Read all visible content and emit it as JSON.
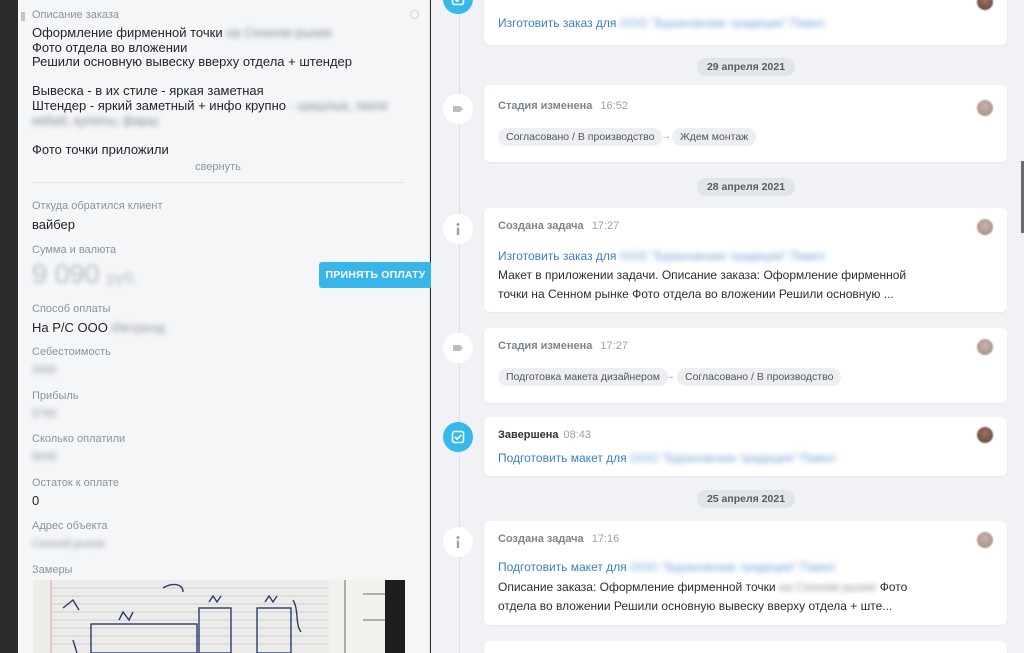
{
  "order": {
    "description_label": "Описание заказа",
    "description_lines": [
      {
        "text": "Оформление фирменной точки",
        "blur": "на Сенном рынке"
      },
      {
        "text": "Фото отдела во вложении",
        "blur": ""
      },
      {
        "text": "Решили основную вывеску вверху отдела + штендер",
        "blur": ""
      },
      {
        "text": "Вывеска - в их стиле - яркая заметная",
        "blur": ""
      },
      {
        "text": "Штендер - яркий заметный + инфо крупно",
        "blur": "- шашлык, люля"
      },
      {
        "text": "",
        "blur": "кебаб, купаты, фарш"
      },
      {
        "text": "Фото точки приложили",
        "blur": ""
      }
    ],
    "collapse_label": "свернуть",
    "source_label": "Откуда обратился клиент",
    "source_value": "вайбер",
    "sum_label": "Сумма и валюта",
    "sum_value": "9 090",
    "sum_currency": "руб.",
    "pay_button": "ПРИНЯТЬ ОПЛАТУ",
    "pay_method_label": "Способ оплаты",
    "pay_method_value": "На Р/С ООО",
    "pay_method_blur": "Ижтренд",
    "cost_label": "Себестоимость",
    "cost_value": "3300",
    "profit_label": "Прибыль",
    "profit_value": "5790",
    "paid_label": "Сколько оплатили",
    "paid_value": "9000",
    "remaining_label": "Остаток к оплате",
    "remaining_value": "0",
    "address_label": "Адрес объекта",
    "address_value": "Сенной рынок",
    "measure_label": "Замеры"
  },
  "timeline": {
    "card0": {
      "link": "Изготовить заказ для",
      "link_blur": "ООО \"Бурановские традиции\" Павел"
    },
    "date1": "29 апреля 2021",
    "card1": {
      "title": "Стадия изменена",
      "time": "16:52",
      "from": "Согласовано / В производство",
      "to": "Ждем монтаж"
    },
    "date2": "28 апреля 2021",
    "card2": {
      "title": "Создана задача",
      "time": "17:27",
      "link": "Изготовить заказ для",
      "link_blur": "ООО \"Бурановские традиции\" Павел",
      "text1": "Макет в приложении задачи. Описание заказа: Оформление фирменной",
      "text2": "точки на Сенном рынке  Фото отдела во вложении Решили основную ..."
    },
    "card3": {
      "title": "Стадия изменена",
      "time": "17:27",
      "from": "Подготовка макета дизайнером",
      "to": "Согласовано / В производство"
    },
    "card4": {
      "title": "Завершена",
      "time": "08:43",
      "link": "Подготовить макет для",
      "link_blur": "ООО \"Бурановские традиции\" Павел"
    },
    "date3": "25 апреля 2021",
    "card5": {
      "title": "Создана задача",
      "time": "17:16",
      "link": "Подготовить макет для",
      "link_blur": "ООО \"Бурановские традиции\" Павел",
      "text1a": "Описание заказа: Оформление фирменной точки",
      "text1b": "на Сенном рынке",
      "text1c": "Фото",
      "text2": "отдела во вложении Решили основную вывеску вверху отдела + ште..."
    },
    "arrow": "→"
  },
  "colors": {
    "accent": "#38b6ea",
    "link": "#3a7ec5"
  }
}
